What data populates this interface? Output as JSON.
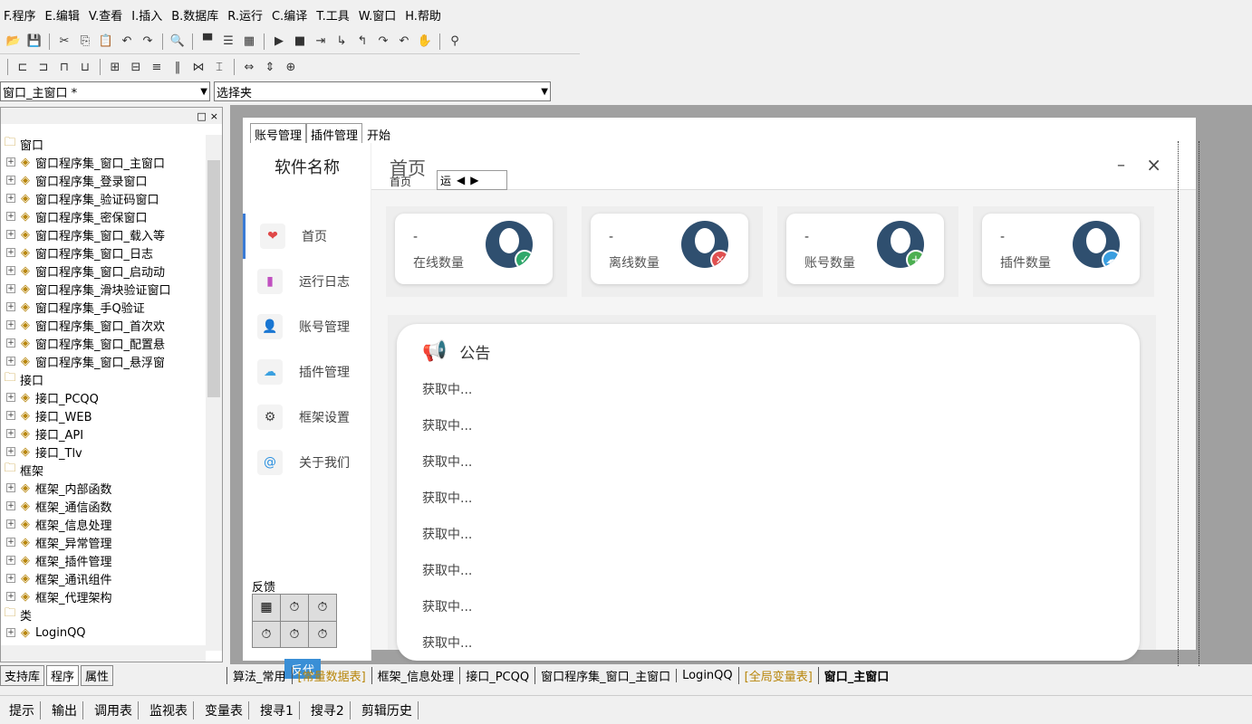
{
  "menu": [
    "F.程序",
    "E.编辑",
    "V.查看",
    "I.插入",
    "B.数据库",
    "R.运行",
    "C.编译",
    "T.工具",
    "W.窗口",
    "H.帮助"
  ],
  "toolbar1_icons": [
    "open-icon",
    "save-icon",
    "cut-icon",
    "copy-icon",
    "paste-icon",
    "undo-icon",
    "redo-icon",
    "find-icon",
    "layout1-icon",
    "layout2-icon",
    "layout3-icon",
    "run-icon",
    "stop-icon",
    "step-icon",
    "stepinto-icon",
    "stepout-icon",
    "stepover-icon",
    "stepback-icon",
    "hand-icon",
    "binoculars-icon"
  ],
  "combo_window": "窗口_主窗口 *",
  "combo_select": "选择夹",
  "tree": [
    {
      "type": "folder",
      "label": "窗口"
    },
    {
      "type": "child",
      "label": "窗口程序集_窗口_主窗口"
    },
    {
      "type": "child",
      "label": "窗口程序集_登录窗口"
    },
    {
      "type": "child",
      "label": "窗口程序集_验证码窗口"
    },
    {
      "type": "child",
      "label": "窗口程序集_密保窗口"
    },
    {
      "type": "child",
      "label": "窗口程序集_窗口_载入等"
    },
    {
      "type": "child",
      "label": "窗口程序集_窗口_日志"
    },
    {
      "type": "child",
      "label": "窗口程序集_窗口_启动动"
    },
    {
      "type": "child",
      "label": "窗口程序集_滑块验证窗口"
    },
    {
      "type": "child",
      "label": "窗口程序集_手Q验证"
    },
    {
      "type": "child",
      "label": "窗口程序集_窗口_首次欢"
    },
    {
      "type": "child",
      "label": "窗口程序集_窗口_配置悬"
    },
    {
      "type": "child",
      "label": "窗口程序集_窗口_悬浮窗"
    },
    {
      "type": "folder",
      "label": "接口"
    },
    {
      "type": "child",
      "label": "接口_PCQQ"
    },
    {
      "type": "child",
      "label": "接口_WEB"
    },
    {
      "type": "child",
      "label": "接口_API"
    },
    {
      "type": "child",
      "label": "接口_Tlv"
    },
    {
      "type": "folder",
      "label": "框架"
    },
    {
      "type": "child",
      "label": "框架_内部函数"
    },
    {
      "type": "child",
      "label": "框架_通信函数"
    },
    {
      "type": "child",
      "label": "框架_信息处理"
    },
    {
      "type": "child",
      "label": "框架_异常管理"
    },
    {
      "type": "child",
      "label": "框架_插件管理"
    },
    {
      "type": "child",
      "label": "框架_通讯组件"
    },
    {
      "type": "child",
      "label": "框架_代理架构"
    },
    {
      "type": "folder",
      "label": "类"
    },
    {
      "type": "child",
      "label": "LoginQQ"
    }
  ],
  "form": {
    "top_tabs": [
      "账号管理",
      "插件管理",
      "开始"
    ],
    "brand": "软件名称",
    "nav": [
      {
        "label": "首页",
        "icon": "heart-icon",
        "glyph": "❤",
        "color": "#e04848"
      },
      {
        "label": "运行日志",
        "icon": "bookmark-icon",
        "glyph": "▮",
        "color": "#c050c0"
      },
      {
        "label": "账号管理",
        "icon": "user-icon",
        "glyph": "👤",
        "color": "#333333"
      },
      {
        "label": "插件管理",
        "icon": "cloud-icon",
        "glyph": "☁",
        "color": "#3aa0e0"
      },
      {
        "label": "框架设置",
        "icon": "gear-icon",
        "glyph": "⚙",
        "color": "#444444"
      },
      {
        "label": "关于我们",
        "icon": "at-icon",
        "glyph": "@",
        "color": "#2a90e0"
      }
    ],
    "feedback_label": "反馈",
    "fan_button": "反代",
    "page_title": "首页",
    "page_sub": "首页",
    "tab_text": "运",
    "min_label": "–",
    "close_label": "×",
    "stats": [
      {
        "value": "-",
        "label": "在线数量",
        "badge": "✓",
        "badge_color": "#2fa86a"
      },
      {
        "value": "-",
        "label": "离线数量",
        "badge": "×",
        "badge_color": "#e05050"
      },
      {
        "value": "-",
        "label": "账号数量",
        "badge": "+",
        "badge_color": "#4caf50"
      },
      {
        "value": "-",
        "label": "插件数量",
        "badge": "☁",
        "badge_color": "#3a9ee0"
      }
    ],
    "announcement_title": "公告",
    "announcements": [
      "获取中...",
      "获取中...",
      "获取中...",
      "获取中...",
      "获取中...",
      "获取中...",
      "获取中...",
      "获取中..."
    ]
  },
  "left_tabs": [
    "支持库",
    "程序",
    "属性"
  ],
  "bottom_tabs": [
    {
      "label": "算法_常用",
      "style": ""
    },
    {
      "label": "[常量数据表]",
      "style": "orange"
    },
    {
      "label": "框架_信息处理",
      "style": ""
    },
    {
      "label": "接口_PCQQ",
      "style": ""
    },
    {
      "label": "窗口程序集_窗口_主窗口",
      "style": ""
    },
    {
      "label": "LoginQQ",
      "style": ""
    },
    {
      "label": "[全局变量表]",
      "style": "orange"
    },
    {
      "label": "窗口_主窗口",
      "style": "bold"
    }
  ],
  "status_items": [
    "提示",
    "输出",
    "调用表",
    "监视表",
    "变量表",
    "搜寻1",
    "搜寻2",
    "剪辑历史"
  ]
}
